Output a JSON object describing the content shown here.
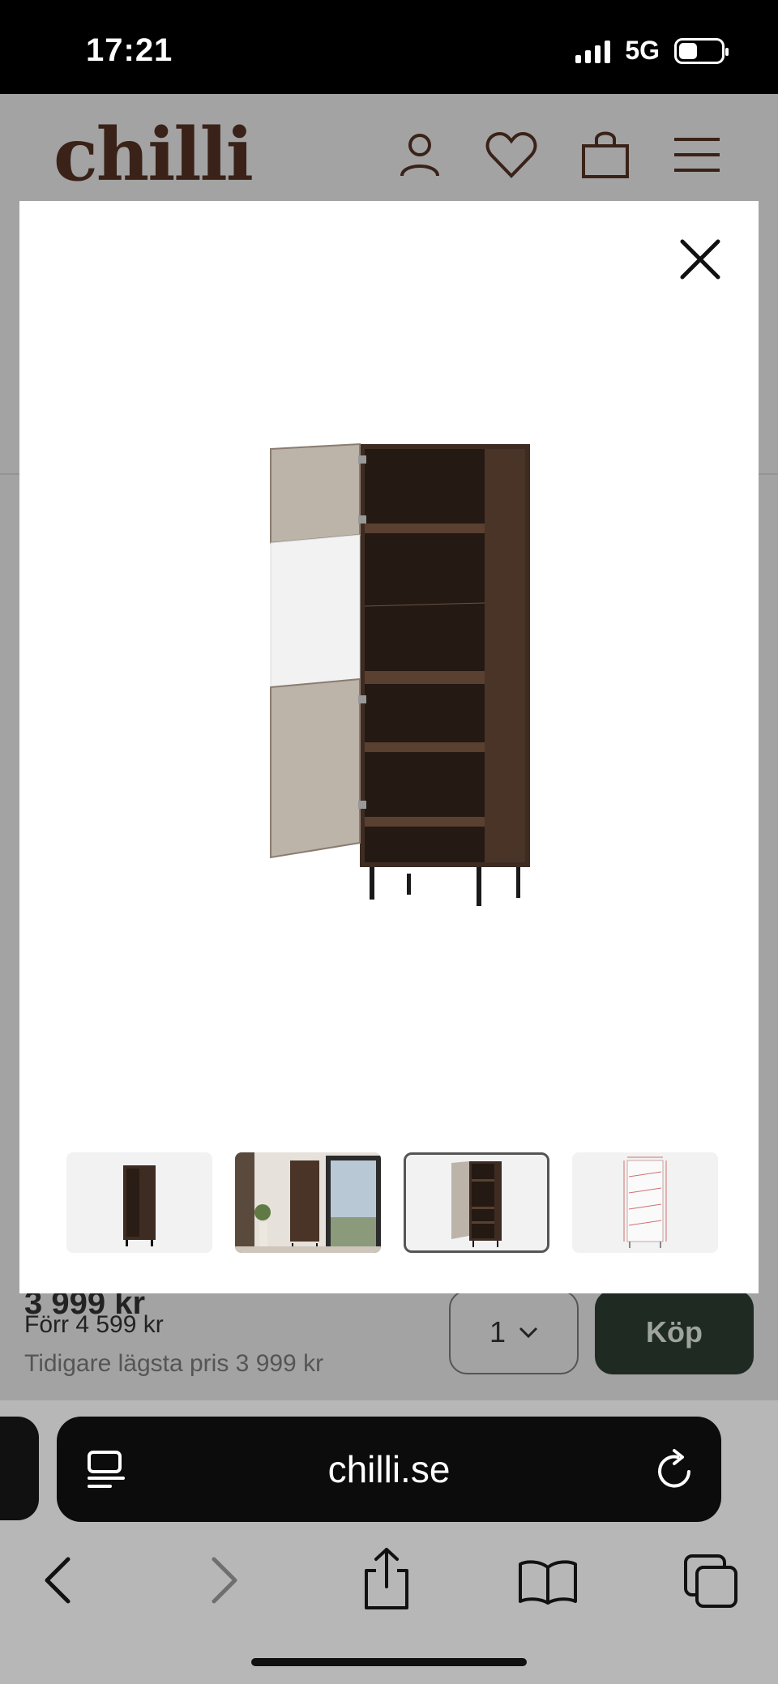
{
  "status_bar": {
    "time": "17:21",
    "network": "5G"
  },
  "header": {
    "logo": "chilli",
    "icons": [
      "account-icon",
      "heart-icon",
      "bag-icon",
      "menu-icon"
    ]
  },
  "product": {
    "price_current": "3 999 kr",
    "price_previous": "Förr 4 599 kr",
    "price_lowest": "Tidigare lägsta pris 3 999 kr",
    "quantity": "1",
    "buy_label": "Köp",
    "buy_color": "#1f2b22"
  },
  "modal": {
    "close_icon": "close-icon",
    "thumbnails": [
      {
        "name": "thumb-front-closed",
        "selected": false
      },
      {
        "name": "thumb-room-scene",
        "selected": false
      },
      {
        "name": "thumb-open-door",
        "selected": true
      },
      {
        "name": "thumb-dimensions",
        "selected": false
      }
    ]
  },
  "browser": {
    "url": "chilli.se",
    "icons": [
      "reader-icon",
      "reload-icon",
      "back-icon",
      "forward-icon",
      "share-icon",
      "bookmarks-icon",
      "tabs-icon"
    ]
  }
}
